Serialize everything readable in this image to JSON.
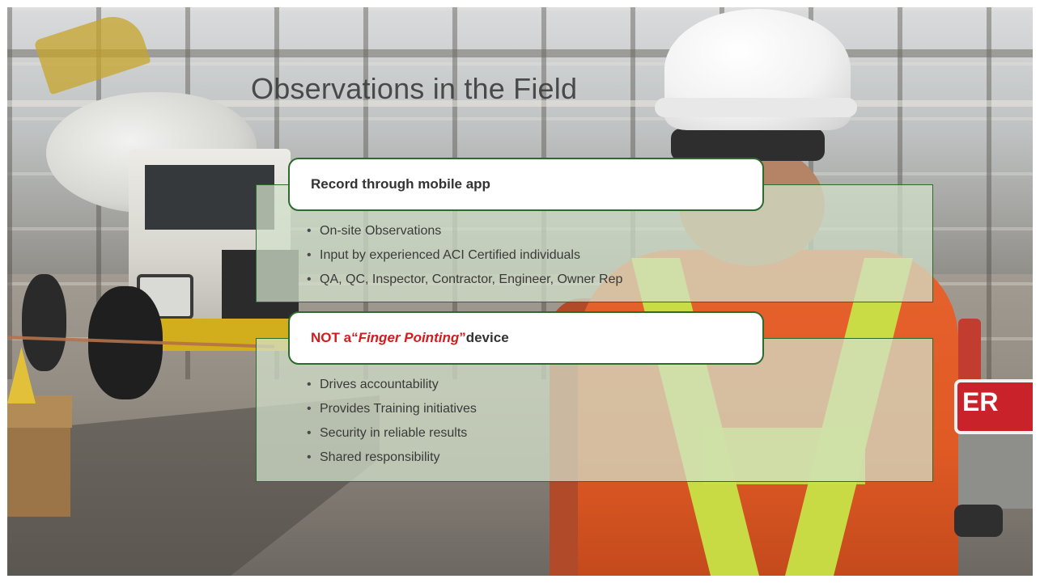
{
  "slide": {
    "title": "Observations in the Field"
  },
  "section_record": {
    "heading": "Record through mobile app",
    "bullets": [
      "On-site Observations",
      "Input by experienced ACI Certified individuals",
      "QA, QC, Inspector, Contractor, Engineer, Owner Rep"
    ]
  },
  "section_not": {
    "heading_prefix": "NOT a ",
    "heading_quote_open": "“",
    "heading_italic": "Finger Pointing",
    "heading_quote_close": "”",
    "heading_suffix": " device",
    "bullets": [
      "Drives accountability",
      "Provides Training initiatives",
      "Security in reliable results",
      "Shared responsibility"
    ]
  },
  "background_sign": {
    "text": "ER"
  },
  "colors": {
    "panel_border": "#2d6a2d",
    "panel_fill": "#d2e0cb",
    "accent_red": "#d61b1b"
  }
}
